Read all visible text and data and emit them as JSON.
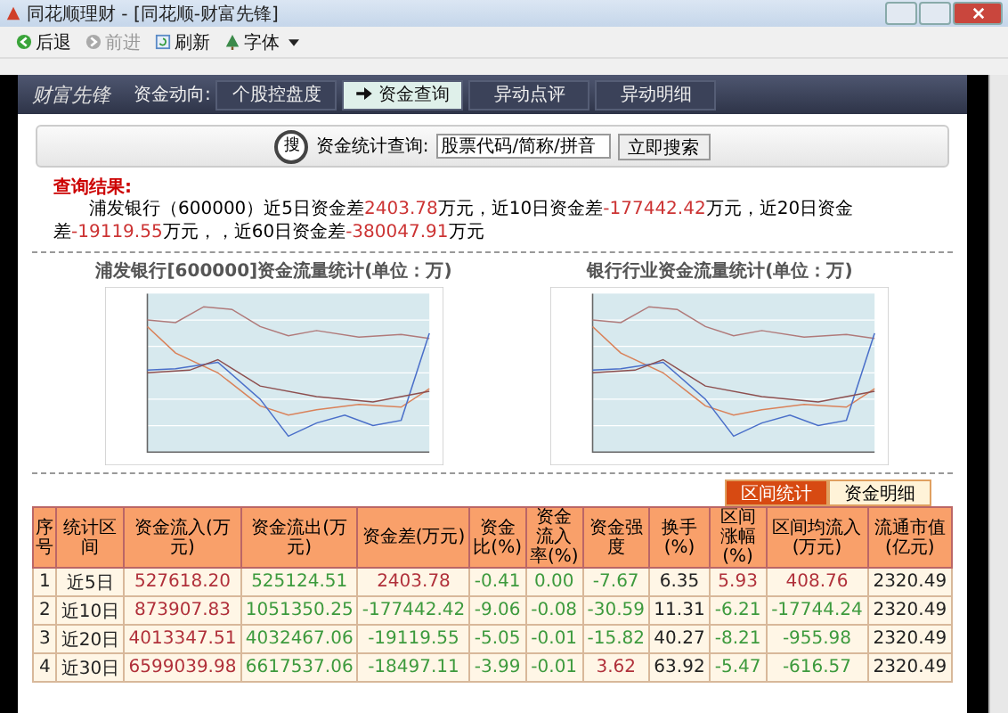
{
  "window": {
    "title": "同花顺理财 - [同花顺-财富先锋]"
  },
  "toolbar": [
    {
      "label": "后退",
      "kind": "back",
      "disabled": false
    },
    {
      "label": "前进",
      "kind": "forward",
      "disabled": true
    },
    {
      "label": "刷新",
      "kind": "refresh",
      "disabled": false
    },
    {
      "label": "字体",
      "kind": "font",
      "disabled": false
    }
  ],
  "nav": {
    "logo": "财富先锋",
    "label": "资金动向:",
    "tabs": [
      {
        "label": "个股控盘度",
        "selected": false
      },
      {
        "label": "资金查询",
        "selected": true
      },
      {
        "label": "异动点评",
        "selected": false
      },
      {
        "label": "异动明细",
        "selected": false
      }
    ]
  },
  "search": {
    "label": "资金统计查询:",
    "value": "股票代码/简称/拼音",
    "button": "立即搜索",
    "icon_text": "搜"
  },
  "result": {
    "heading": "查询结果:",
    "text": "浦发银行（600000）近5日资金差**2403.78**万元，近10日资金差**-177442.42**万元，近20日资金差**-19119.55**万元，，近60日资金差**-380047.91**万元"
  },
  "charts": [
    {
      "title": "浦发银行[600000]资金流量统计(单位：万)"
    },
    {
      "title": "银行行业资金流量统计(单位：万)"
    }
  ],
  "table_tabs": [
    {
      "label": "区间统计",
      "selected": true
    },
    {
      "label": "资金明细",
      "selected": false
    }
  ],
  "table": {
    "columns": [
      "序号",
      "统计区间",
      "资金流入(万元)",
      "资金流出(万元)",
      "资金差(万元)",
      "资金比(%)",
      "资金流入率(%)",
      "资金强度",
      "换手(%)",
      "区间涨幅(%)",
      "区间均流入(万元)",
      "流通市值(亿元)"
    ],
    "rows": [
      [
        "1",
        "近5日",
        "527618.20",
        "525124.51",
        "2403.78",
        "-0.41",
        "0.00",
        "-7.67",
        "6.35",
        "5.93",
        "408.76",
        "2320.49"
      ],
      [
        "2",
        "近10日",
        "873907.83",
        "1051350.25",
        "-177442.42",
        "-9.06",
        "-0.08",
        "-30.59",
        "11.31",
        "-6.21",
        "-17744.24",
        "2320.49"
      ],
      [
        "3",
        "近20日",
        "4013347.51",
        "4032467.06",
        "-19119.55",
        "-5.05",
        "-0.01",
        "-15.82",
        "40.27",
        "-8.21",
        "-955.98",
        "2320.49"
      ],
      [
        "4",
        "近30日",
        "6599039.98",
        "6617537.06",
        "-18497.11",
        "-3.99",
        "-0.01",
        "3.62",
        "63.92",
        "-5.47",
        "-616.57",
        "2320.49"
      ]
    ]
  }
}
